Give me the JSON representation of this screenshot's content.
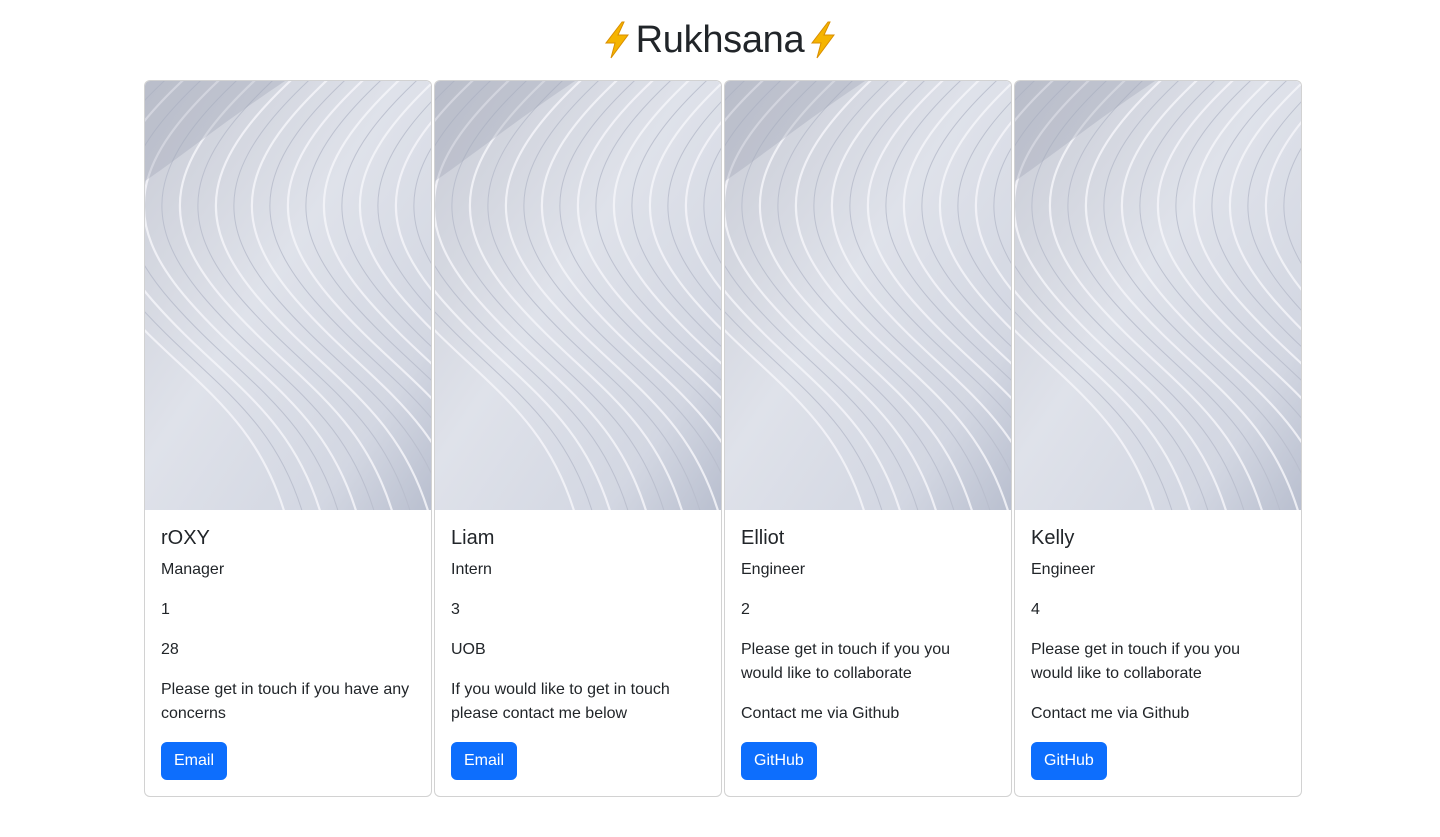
{
  "header": {
    "title": "Rukhsana",
    "icon": "lightning-bolt-icon",
    "icon_color": "#f5b400"
  },
  "theme": {
    "button_color": "#0d6efd",
    "button_text_color": "#ffffff"
  },
  "cards": [
    {
      "name": "rOXY",
      "role": "Manager",
      "id": "1",
      "extra": "28",
      "message": "Please get in touch if you have any concerns",
      "button_label": "Email"
    },
    {
      "name": "Liam",
      "role": "Intern",
      "id": "3",
      "extra": "UOB",
      "message": "If you would like to get in touch please contact me below",
      "button_label": "Email"
    },
    {
      "name": "Elliot",
      "role": "Engineer",
      "id": "2",
      "extra": "Please get in touch if you you would like to collaborate",
      "message": "Contact me via Github",
      "button_label": "GitHub"
    },
    {
      "name": "Kelly",
      "role": "Engineer",
      "id": "4",
      "extra": "Please get in touch if you you would like to collaborate",
      "message": "Contact me via Github",
      "button_label": "GitHub"
    }
  ]
}
